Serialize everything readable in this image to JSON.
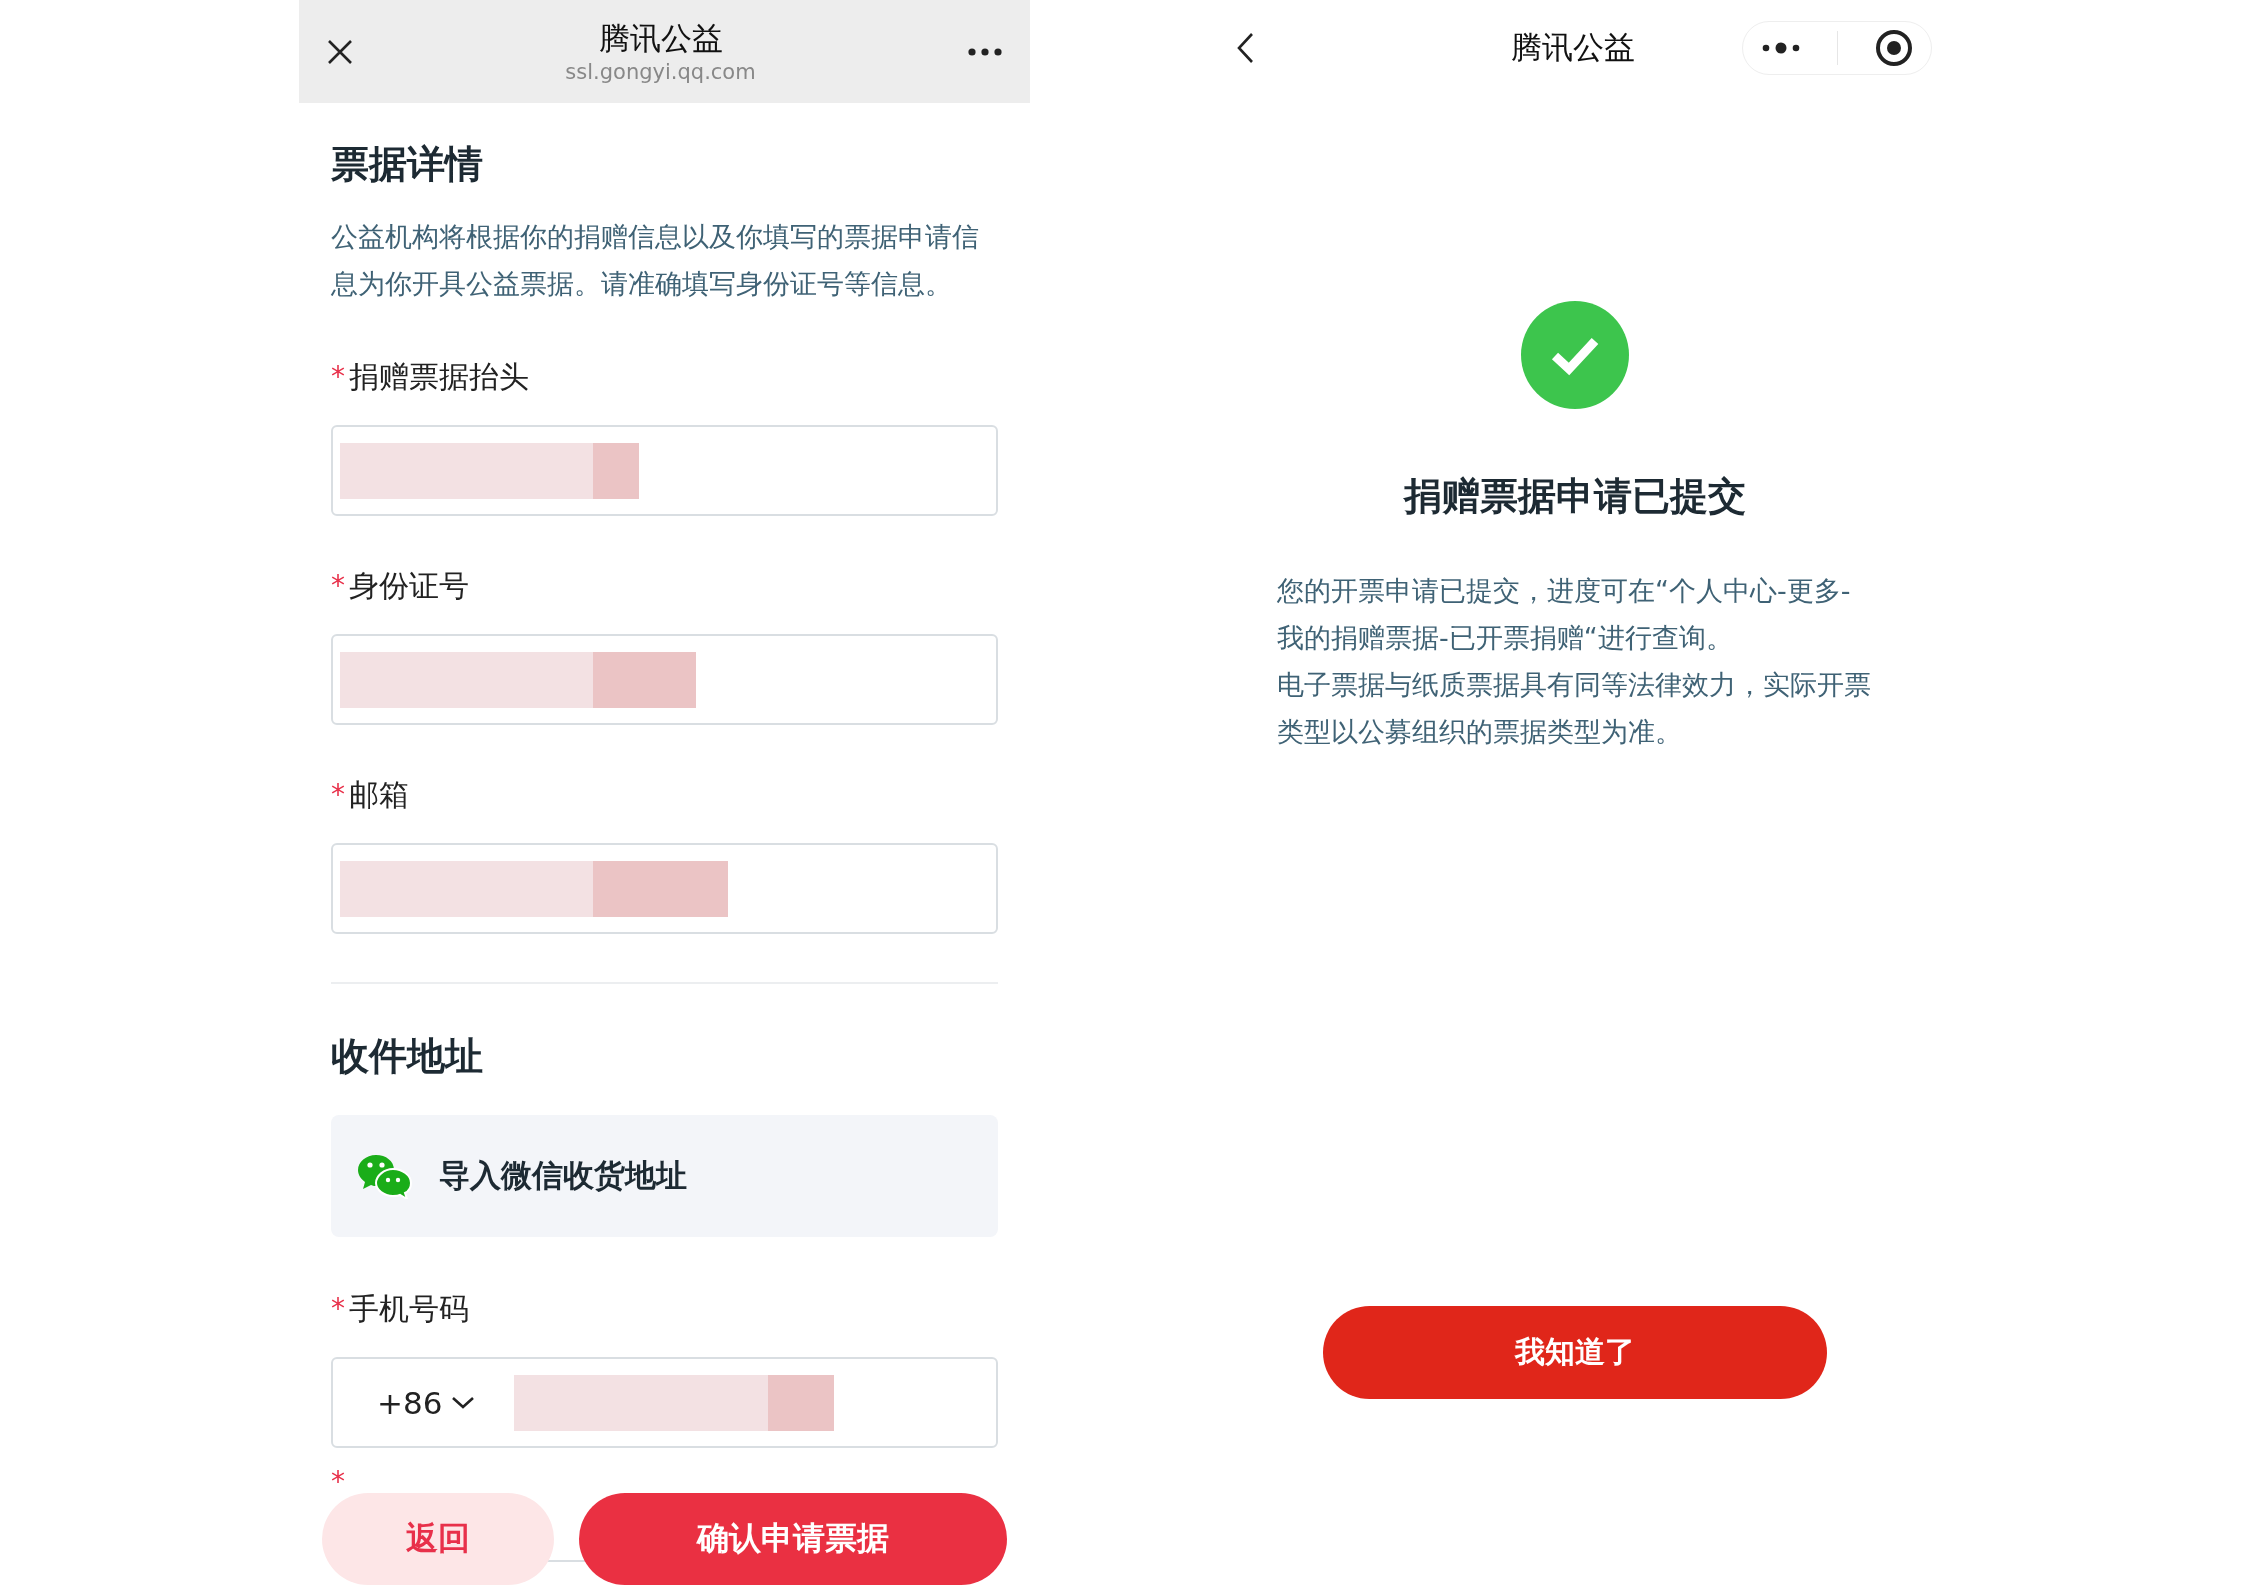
{
  "left_screen": {
    "nav": {
      "title": "腾讯公益",
      "url": "ssl.gongyi.qq.com"
    },
    "section_title": "票据详情",
    "description": "公益机构将根据你的捐赠信息以及你填写的票据申请信息为你开具公益票据。请准确填写身份证号等信息。",
    "fields": [
      {
        "label": "捐赠票据抬头",
        "required": true
      },
      {
        "label": "身份证号",
        "required": true
      },
      {
        "label": "邮箱",
        "required": true
      }
    ],
    "address_title": "收件地址",
    "import_button": "导入微信收货地址",
    "phone": {
      "label": "手机号码",
      "required": true,
      "country_code": "+86"
    },
    "next_field_marker": "*",
    "buttons": {
      "back": "返回",
      "confirm": "确认申请票据"
    }
  },
  "right_screen": {
    "nav": {
      "title": "腾讯公益"
    },
    "result_title": "捐赠票据申请已提交",
    "paragraphs": [
      "您的开票申请已提交，进度可在“个人中心-更多-我的捐赠票据-已开票捐赠“进行查询。",
      "电子票据与纸质票据具有同等法律效力，实际开票类型以公募组织的票据类型为准。"
    ],
    "ok_button": "我知道了"
  }
}
